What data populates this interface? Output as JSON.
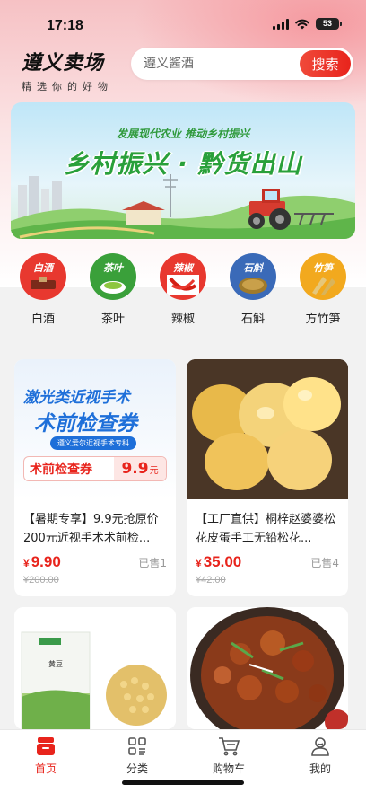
{
  "status_bar": {
    "time": "17:18",
    "battery": "53"
  },
  "header": {
    "logo_title": "遵义卖场",
    "logo_subtitle": "精选你的好物",
    "search_placeholder": "遵义酱酒",
    "search_button": "搜索"
  },
  "banner": {
    "subtitle": "发展现代农业  推动乡村振兴",
    "title": "乡村振兴 · 黔货出山"
  },
  "categories": [
    {
      "label": "白酒",
      "tag": "白酒",
      "color": "#e8382f"
    },
    {
      "label": "茶叶",
      "tag": "茶叶",
      "color": "#3aa03a"
    },
    {
      "label": "辣椒",
      "tag": "辣椒",
      "color": "#e8382f"
    },
    {
      "label": "石斛",
      "tag": "石斛",
      "color": "#3a6ab8"
    },
    {
      "label": "方竹笋",
      "tag": "竹笋",
      "color": "#f2a91e"
    }
  ],
  "products": [
    {
      "title": "【暑期专享】9.9元抢原价200元近视手术术前检...",
      "currency": "¥",
      "price": "9.90",
      "sold": "已售1",
      "original_price": "¥200.00",
      "image": {
        "line1": "激光类近视手术",
        "line2": "术前检查券",
        "tag": "遵义爱尔近视手术专科",
        "coupon_label": "术前检查券",
        "coupon_price": "9.9",
        "coupon_unit": "元"
      }
    },
    {
      "title": "【工厂直供】桐梓赵婆婆松花皮蛋手工无铅松花...",
      "currency": "¥",
      "price": "35.00",
      "sold": "已售4",
      "original_price": "¥42.00"
    },
    {
      "title": "",
      "price": "",
      "sold": "",
      "original_price": "",
      "image": {
        "bag_text": "黄豆"
      }
    },
    {
      "title": "",
      "price": "",
      "sold": "",
      "original_price": ""
    }
  ],
  "tabbar": [
    {
      "label": "首页",
      "icon": "home-icon",
      "active": true
    },
    {
      "label": "分类",
      "icon": "category-icon",
      "active": false
    },
    {
      "label": "购物车",
      "icon": "cart-icon",
      "active": false
    },
    {
      "label": "我的",
      "icon": "profile-icon",
      "active": false
    }
  ],
  "colors": {
    "accent": "#e8241c",
    "banner_green": "#29a03a"
  }
}
